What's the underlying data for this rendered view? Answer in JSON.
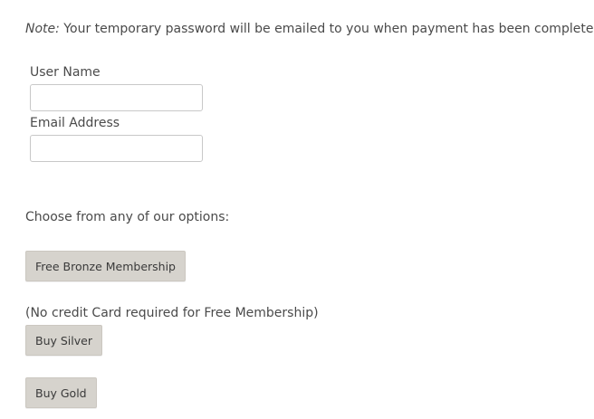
{
  "note": {
    "prefix": "Note:",
    "text": " Your temporary password will be emailed to you when payment has been completed."
  },
  "form": {
    "username": {
      "label": "User Name",
      "value": "",
      "placeholder": ""
    },
    "email": {
      "label": "Email Address",
      "value": "",
      "placeholder": ""
    }
  },
  "options": {
    "heading": "Choose from any of our options:",
    "bronze_button": "Free Bronze Membership",
    "no_credit_note": "(No credit Card required for Free Membership)",
    "silver_button": "Buy Silver",
    "gold_button": "Buy Gold"
  },
  "colors": {
    "text": "#4a4a4a",
    "button_bg": "#d6d3cd",
    "input_border": "#c8c8c8"
  }
}
